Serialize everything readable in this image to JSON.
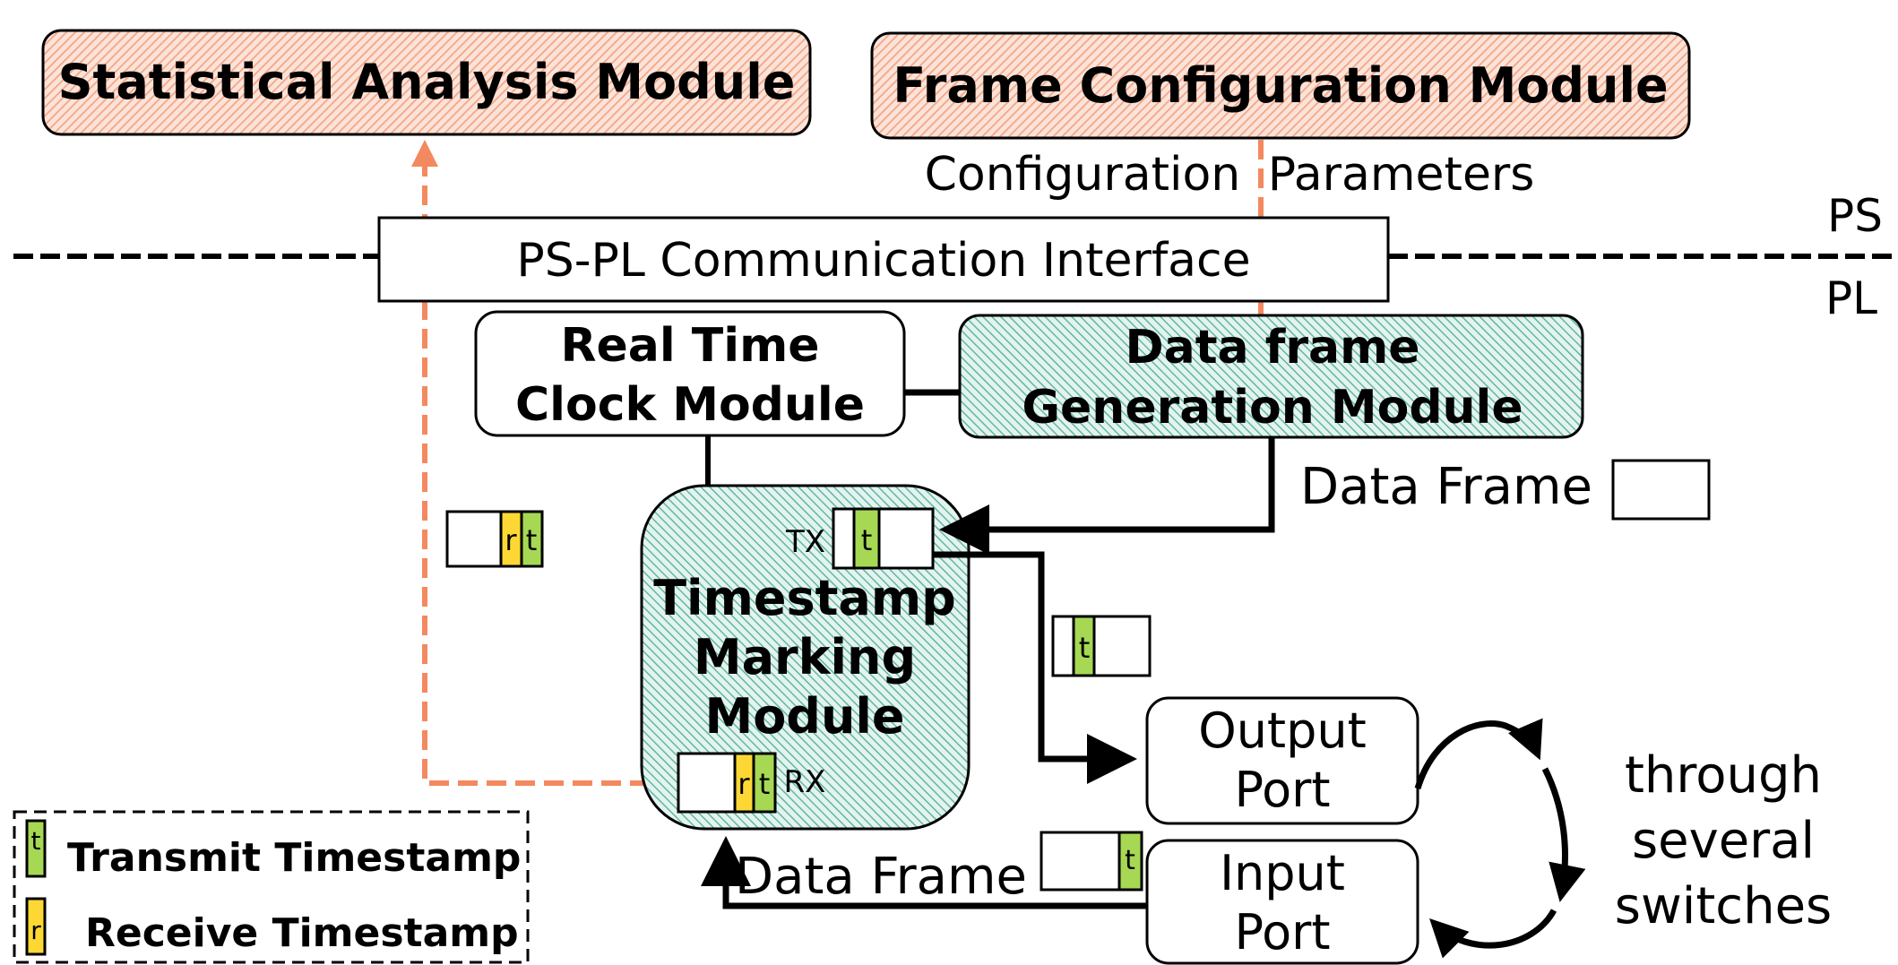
{
  "diagram": {
    "regions": {
      "upper": "PS",
      "lower": "PL"
    },
    "modules": {
      "statistical_analysis": "Statistical Analysis Module",
      "frame_configuration": "Frame Configuration Module",
      "ps_pl_interface": "PS-PL Communication Interface",
      "rtc_line1": "Real Time",
      "rtc_line2": "Clock Module",
      "dfg_line1": "Data frame",
      "dfg_line2": "Generation Module",
      "tmm_line1": "Timestamp",
      "tmm_line2": "Marking",
      "tmm_line3": "Module",
      "output_port_line1": "Output",
      "output_port_line2": "Port",
      "input_port_line1": "Input",
      "input_port_line2": "Port"
    },
    "labels": {
      "config_params": "Configuration Parameters",
      "data_frame_top": "Data Frame",
      "data_frame_bottom": "Data Frame",
      "tx": "TX",
      "rx": "RX",
      "switches_line1": "through",
      "switches_line2": "several",
      "switches_line3": "switches"
    },
    "frame_fields": {
      "transmit": "t",
      "receive": "r"
    },
    "legend": {
      "items": [
        {
          "glyph": "t",
          "label": "Transmit Timestamp",
          "color": "#A6D854"
        },
        {
          "glyph": "r",
          "label": "Receive Timestamp",
          "color": "#FDD835"
        }
      ]
    },
    "colors": {
      "ps_module_hatch": "#F4A582",
      "ps_module_bg": "#FBE3DA",
      "pl_module_hatch": "#5FB8A0",
      "pl_module_bg": "#E4F3EF",
      "transmit_timestamp": "#A6D854",
      "receive_timestamp": "#FDD835",
      "stats_path": "#F4895F"
    }
  }
}
